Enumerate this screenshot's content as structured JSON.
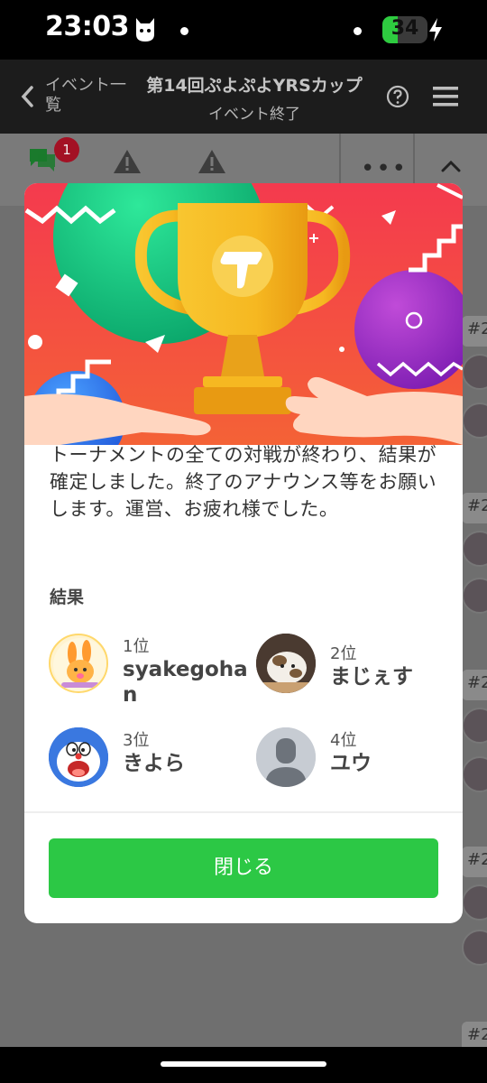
{
  "status_bar": {
    "time": "23:03",
    "battery": "34",
    "battery_level_pct": 34
  },
  "header": {
    "back_label": "イベント一覧",
    "title": "第14回ぷよぷよYRSカップ",
    "subtitle": "イベント終了"
  },
  "tabs": {
    "chat_badge": "1",
    "more": "•••"
  },
  "background_tags": [
    "#2",
    "#2",
    "#2",
    "#2",
    "#2"
  ],
  "modal": {
    "message": "トーナメントの全ての対戦が終わり、結果が確定しました。終了のアナウンス等をお願いします。運営、お疲れ様でした。",
    "results_label": "結果",
    "results": [
      {
        "rank": "1位",
        "name": "syakegohan"
      },
      {
        "rank": "2位",
        "name": "まじぇす"
      },
      {
        "rank": "3位",
        "name": "きよら"
      },
      {
        "rank": "4位",
        "name": "ユウ"
      }
    ],
    "close_label": "閉じる"
  },
  "colors": {
    "accent_green": "#2cc845",
    "badge_red": "#a31124",
    "banner_red": "#f2434a",
    "trophy_gold": "#f6b821"
  }
}
